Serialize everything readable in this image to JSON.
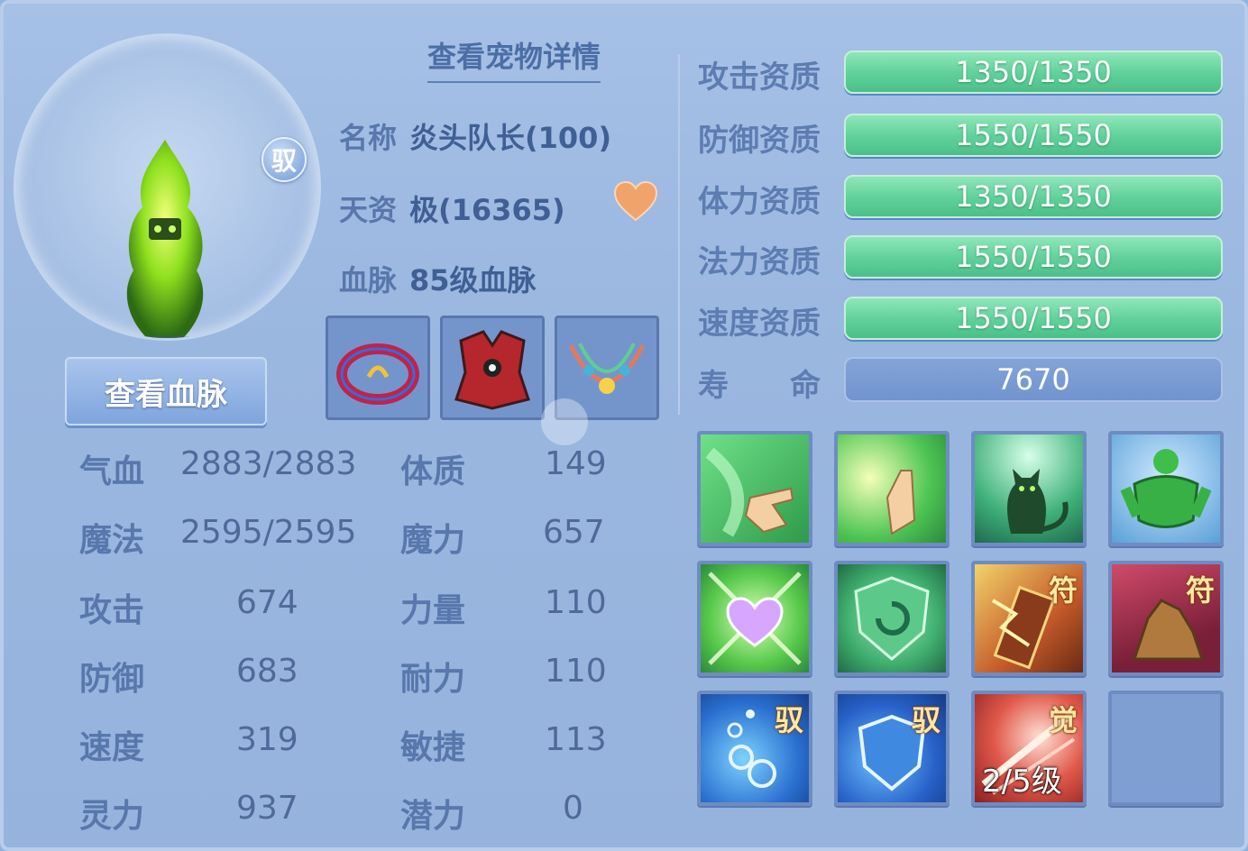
{
  "header": {
    "detail_link": "查看宠物详情"
  },
  "pet": {
    "badge": "驭",
    "bloodline_button": "查看血脉",
    "name_key": "名称",
    "name_val": "炎头队长(100)",
    "talent_key": "天资",
    "talent_val": "极(16365)",
    "blood_key": "血脉",
    "blood_val": "85级血脉"
  },
  "equipment": [
    {
      "name": "ring"
    },
    {
      "name": "armor"
    },
    {
      "name": "necklace"
    }
  ],
  "stats_left": [
    {
      "key": "气血",
      "val": "2883/2883"
    },
    {
      "key": "魔法",
      "val": "2595/2595"
    },
    {
      "key": "攻击",
      "val": "674"
    },
    {
      "key": "防御",
      "val": "683"
    },
    {
      "key": "速度",
      "val": "319"
    },
    {
      "key": "灵力",
      "val": "937"
    }
  ],
  "stats_right": [
    {
      "key": "体质",
      "val": "149"
    },
    {
      "key": "魔力",
      "val": "657"
    },
    {
      "key": "力量",
      "val": "110"
    },
    {
      "key": "耐力",
      "val": "110"
    },
    {
      "key": "敏捷",
      "val": "113"
    },
    {
      "key": "潜力",
      "val": "0"
    }
  ],
  "aptitudes": [
    {
      "label": "攻击资质",
      "val": "1350/1350"
    },
    {
      "label": "防御资质",
      "val": "1550/1550"
    },
    {
      "label": "体力资质",
      "val": "1350/1350"
    },
    {
      "label": "法力资质",
      "val": "1550/1550"
    },
    {
      "label": "速度资质",
      "val": "1550/1550"
    }
  ],
  "life": {
    "label": "寿　　命",
    "val": "7670"
  },
  "skills": [
    {
      "icon": "finger-point-skill-icon"
    },
    {
      "icon": "palm-light-skill-icon"
    },
    {
      "icon": "green-cat-skill-icon"
    },
    {
      "icon": "green-muscle-skill-icon"
    },
    {
      "icon": "heart-skill-icon"
    },
    {
      "icon": "shield-swirl-skill-icon"
    },
    {
      "icon": "lightning-scroll-skill-icon",
      "tag": "符"
    },
    {
      "icon": "rock-skill-icon",
      "tag": "符"
    },
    {
      "icon": "bubbles-skill-icon",
      "tag": "驭"
    },
    {
      "icon": "blue-shield-skill-icon",
      "tag": "驭"
    },
    {
      "icon": "awaken-skill-icon",
      "tag": "觉",
      "level": "2/5级"
    },
    {
      "icon": "empty-skill-slot"
    }
  ],
  "colors": {
    "panel": "#9ab7e0",
    "bar_green": "#5fd09a",
    "label_blue": "#5877ac"
  }
}
